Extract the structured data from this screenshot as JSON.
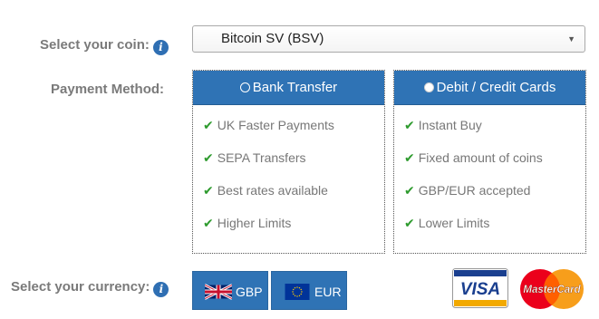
{
  "coin": {
    "label": "Select your coin:",
    "selected": "Bitcoin SV (BSV)"
  },
  "payment": {
    "label": "Payment Method:",
    "options": [
      {
        "title": "Bank Transfer",
        "selected": true,
        "features": [
          "UK Faster Payments",
          "SEPA Transfers",
          "Best rates available",
          "Higher Limits"
        ]
      },
      {
        "title": "Debit / Credit Cards",
        "selected": false,
        "features": [
          "Instant Buy",
          "Fixed amount of coins",
          "GBP/EUR accepted",
          "Lower Limits"
        ]
      }
    ]
  },
  "currency": {
    "label": "Select your currency:",
    "options": [
      {
        "code": "GBP",
        "flag": "uk-flag-icon"
      },
      {
        "code": "EUR",
        "flag": "eu-flag-icon"
      }
    ]
  },
  "cards": {
    "visa": "VISA",
    "mastercard": "MasterCard"
  },
  "colors": {
    "accent": "#2f73b5",
    "check": "#2e9b2e",
    "label": "#7a7a7a"
  }
}
